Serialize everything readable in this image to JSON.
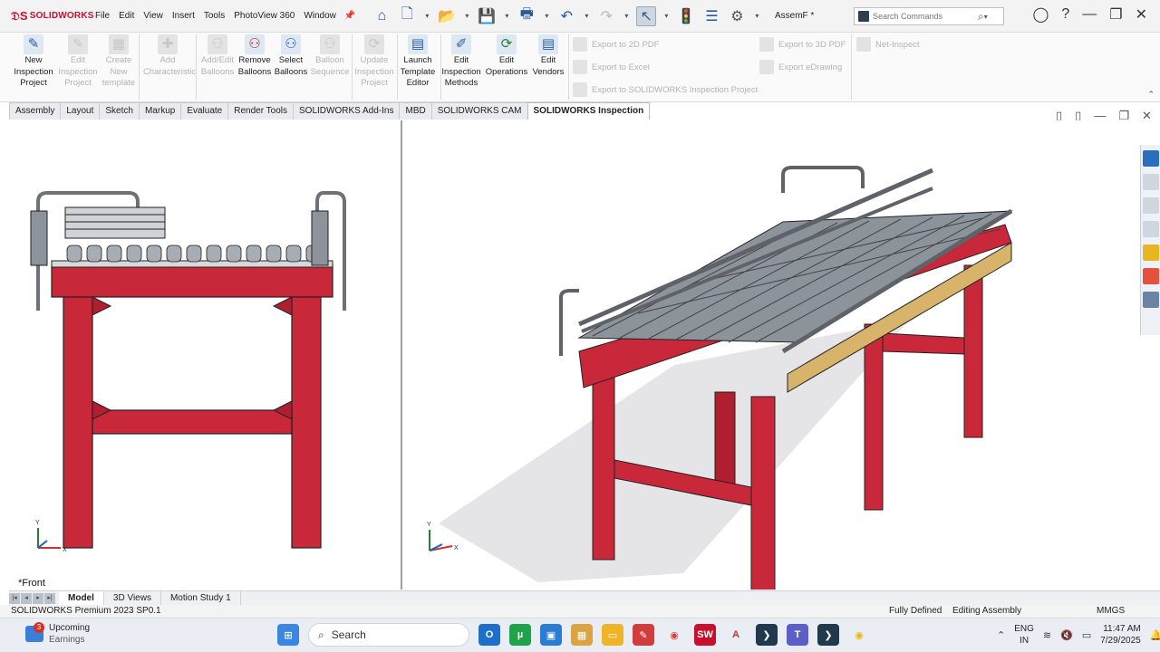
{
  "app": {
    "brand": "SOLIDWORKS",
    "menus": [
      "File",
      "Edit",
      "View",
      "Insert",
      "Tools",
      "PhotoView 360",
      "Window"
    ],
    "document_title": "AssemF *",
    "search_placeholder": "Search Commands"
  },
  "ribbon": {
    "inspection_group": [
      {
        "label": "New Inspection Project",
        "enabled": true
      },
      {
        "label": "Edit Inspection Project",
        "enabled": false
      },
      {
        "label": "Create New template",
        "enabled": false
      },
      {
        "label": "Add Characteristic",
        "enabled": false
      },
      {
        "label": "Add/Edit Balloons",
        "enabled": false
      },
      {
        "label": "Remove Balloons",
        "enabled": true
      },
      {
        "label": "Select Balloons",
        "enabled": true
      },
      {
        "label": "Balloon Sequence",
        "enabled": false
      },
      {
        "label": "Update Inspection Project",
        "enabled": false
      },
      {
        "label": "Launch Template Editor",
        "enabled": true
      },
      {
        "label": "Edit Inspection Methods",
        "enabled": true
      },
      {
        "label": "Edit Operations",
        "enabled": true
      },
      {
        "label": "Edit Vendors",
        "enabled": true
      }
    ],
    "exports": {
      "pdf_2d": "Export to 2D PDF",
      "excel": "Export to Excel",
      "sw_project": "Export to SOLIDWORKS Inspection Project",
      "pdf_3d": "Export to 3D PDF",
      "edrawing": "Export eDrawing",
      "net_inspect": "Net-Inspect"
    }
  },
  "tabs": [
    "Assembly",
    "Layout",
    "Sketch",
    "Markup",
    "Evaluate",
    "Render Tools",
    "SOLIDWORKS Add-Ins",
    "MBD",
    "SOLIDWORKS CAM",
    "SOLIDWORKS Inspection"
  ],
  "active_tab": "SOLIDWORKS Inspection",
  "viewport": {
    "left_view_label": "*Front",
    "triad_x": "X",
    "triad_y": "Y"
  },
  "bottom_tabs": [
    "Model",
    "3D Views",
    "Motion Study 1"
  ],
  "status": {
    "version": "SOLIDWORKS Premium 2023 SP0.1",
    "defined": "Fully Defined",
    "mode": "Editing Assembly",
    "units": "MMGS"
  },
  "taskbar": {
    "weather_title": "Upcoming",
    "weather_sub": "Earnings",
    "badge": "3",
    "search_label": "Search",
    "lang_1": "ENG",
    "lang_2": "IN",
    "time": "11:47 AM",
    "date": "7/29/2025"
  },
  "colors": {
    "frame_red": "#c8283a",
    "roller_grey": "#8d939b",
    "accent_blue": "#2a5b9e",
    "brand_red": "#c8102e"
  }
}
